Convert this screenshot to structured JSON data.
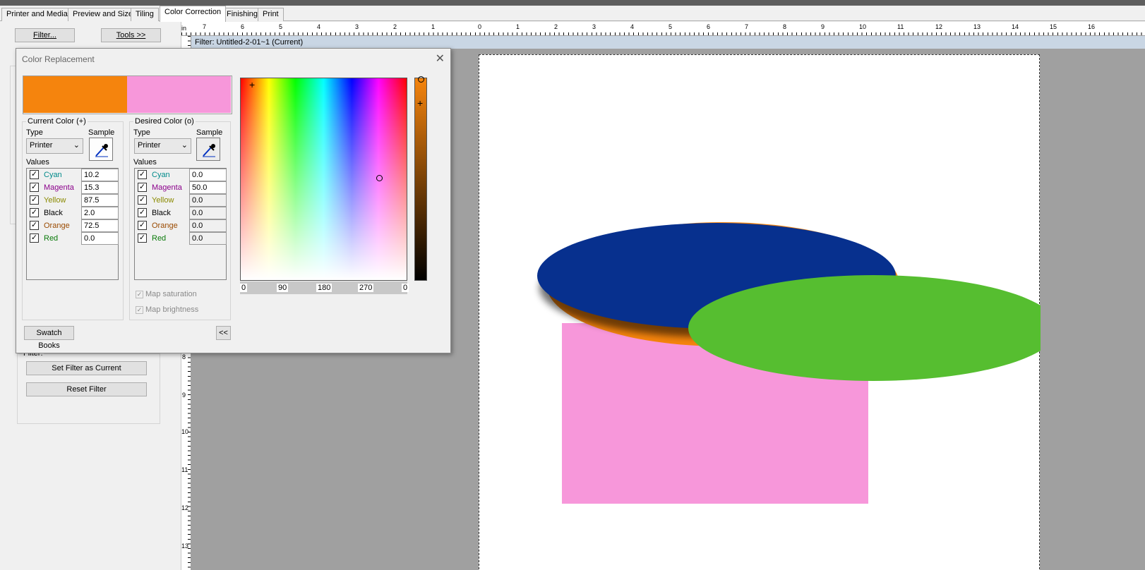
{
  "tabs": [
    "Printer and Media",
    "Preview and Size",
    "Tiling",
    "Color Correction",
    "Finishing",
    "Print"
  ],
  "left_panel": {
    "filter_button": "Filter...",
    "tools_button": "Tools >>",
    "filter_group_label": "Filter:",
    "set_filter_button": "Set Filter as Current",
    "reset_filter_button": "Reset Filter"
  },
  "rulers": {
    "unit": "in",
    "h_ticks": [
      "7",
      "6",
      "5",
      "4",
      "3",
      "2",
      "1",
      "0",
      "1",
      "2",
      "3",
      "4",
      "5",
      "6",
      "7",
      "8",
      "9",
      "10",
      "11",
      "12",
      "13",
      "14",
      "15",
      "16"
    ],
    "v_ticks": [
      "8",
      "9",
      "10",
      "11",
      "12",
      "13"
    ]
  },
  "filter_bar": {
    "text": "Filter: Untitled-2-01~1 (Current)"
  },
  "dialog": {
    "title": "Color Replacement",
    "close_icon": "close-icon",
    "current_color": {
      "label": "Current Color (+)",
      "swatch": "#f5840d",
      "type_label": "Type",
      "type_value": "Printer",
      "sample_label": "Sample",
      "values_label": "Values",
      "rows": [
        {
          "name": "Cyan",
          "value": "10.2"
        },
        {
          "name": "Magenta",
          "value": "15.3"
        },
        {
          "name": "Yellow",
          "value": "87.5"
        },
        {
          "name": "Black",
          "value": "2.0"
        },
        {
          "name": "Orange",
          "value": "72.5"
        },
        {
          "name": "Red",
          "value": "0.0"
        }
      ]
    },
    "desired_color": {
      "label": "Desired Color (o)",
      "swatch": "#f797da",
      "type_label": "Type",
      "type_value": "Printer",
      "sample_label": "Sample",
      "values_label": "Values",
      "rows": [
        {
          "name": "Cyan",
          "value": "0.0"
        },
        {
          "name": "Magenta",
          "value": "50.0"
        },
        {
          "name": "Yellow",
          "value": "0.0"
        },
        {
          "name": "Black",
          "value": "0.0"
        },
        {
          "name": "Orange",
          "value": "0.0"
        },
        {
          "name": "Red",
          "value": "0.0"
        }
      ],
      "map_saturation": "Map saturation",
      "map_brightness": "Map brightness"
    },
    "hue_axis": [
      "0",
      "90",
      "180",
      "270",
      "0"
    ],
    "swatch_books_button": "Swatch Books",
    "collapse_button": "<<"
  },
  "artwork": {
    "blue": "#07308e",
    "green": "#56be30",
    "pink": "#f797da",
    "orange": "#f5840d"
  }
}
